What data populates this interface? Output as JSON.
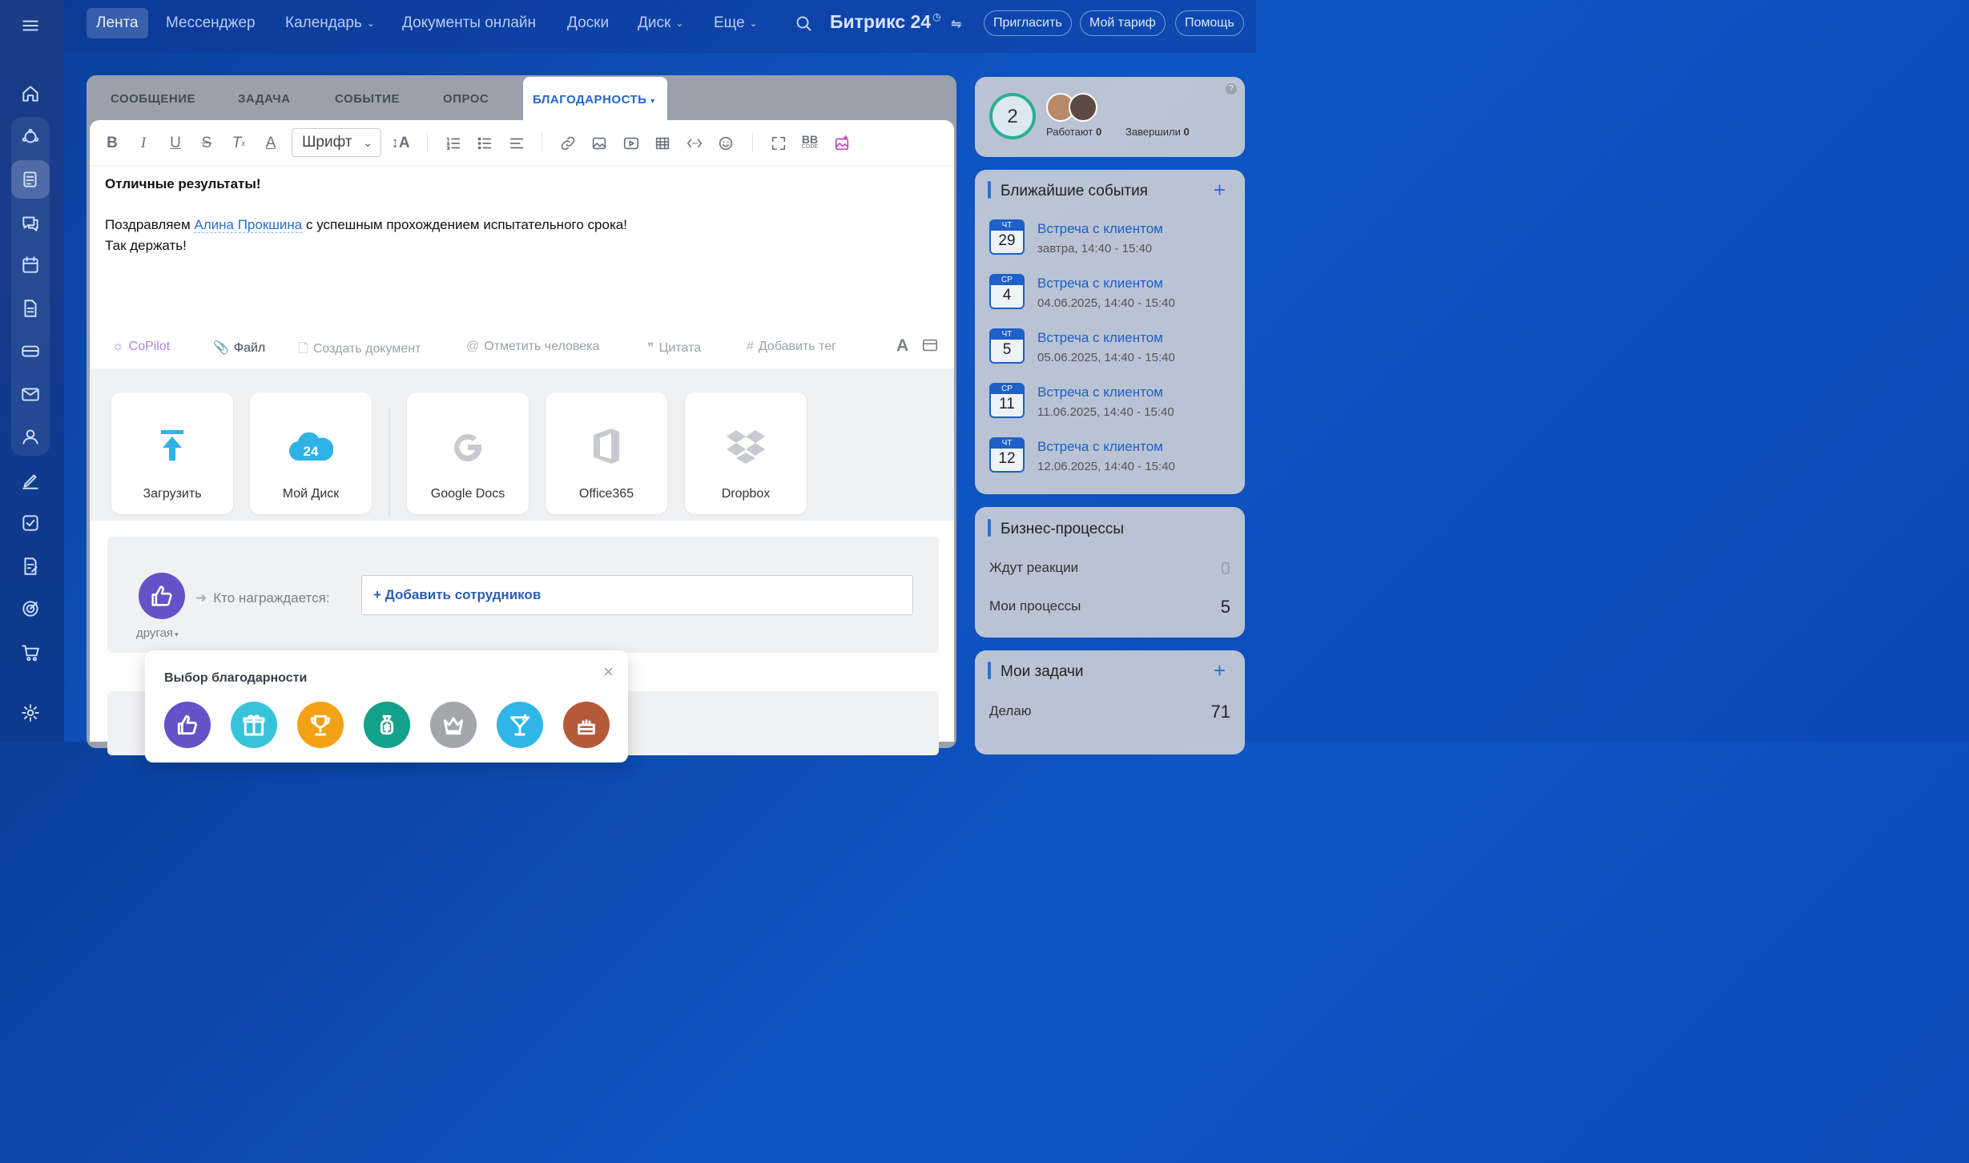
{
  "topbar": {
    "nav": [
      {
        "label": "Лента"
      },
      {
        "label": "Мессенджер"
      },
      {
        "label": "Календарь"
      },
      {
        "label": "Документы онлайн"
      },
      {
        "label": "Доски"
      },
      {
        "label": "Диск"
      },
      {
        "label": "Еще"
      }
    ],
    "brand": "Битрикс 24",
    "invite": "Пригласить",
    "tariff": "Мой тариф",
    "help": "Помощь"
  },
  "composer": {
    "tabs": [
      "СООБЩЕНИЕ",
      "ЗАДАЧА",
      "СОБЫТИЕ",
      "ОПРОС",
      "БЛАГОДАРНОСТЬ"
    ],
    "font_select": "Шрифт",
    "bbcode": "BB",
    "bbcode_sub": "CODE",
    "message_title": "Отличные результаты!",
    "line1_prefix": "Поздравляем",
    "line1_mention": "Алина Прокшина",
    "line1_suffix": "с успешным прохождением испытательного срока!",
    "line2": "Так держать!",
    "actions": {
      "copilot": "CoPilot",
      "file": "Файл",
      "create_doc": "Создать документ",
      "mention": "Отметить человека",
      "quote": "Цитата",
      "tag": "Добавить тег"
    },
    "upload_cards": [
      "Загрузить",
      "Мой Диск",
      "Google Docs",
      "Office365",
      "Dropbox"
    ],
    "gratitude": {
      "who_label": "Кто награждается:",
      "add_employees": "+ Добавить сотрудников",
      "kind": "другая"
    },
    "popup": {
      "title": "Выбор благодарности",
      "close": "×"
    }
  },
  "right": {
    "online_count": "2",
    "working_label": "Работают",
    "working_value": "0",
    "done_label": "Завершили",
    "done_value": "0",
    "events_title": "Ближайшие события",
    "events": [
      {
        "dow": "ЧТ",
        "day": "29",
        "title": "Встреча с клиентом",
        "time": "завтра, 14:40 - 15:40"
      },
      {
        "dow": "СР",
        "day": "4",
        "title": "Встреча с клиентом",
        "time": "04.06.2025, 14:40 - 15:40"
      },
      {
        "dow": "ЧТ",
        "day": "5",
        "title": "Встреча с клиентом",
        "time": "05.06.2025, 14:40 - 15:40"
      },
      {
        "dow": "СР",
        "day": "11",
        "title": "Встреча с клиентом",
        "time": "11.06.2025, 14:40 - 15:40"
      },
      {
        "dow": "ЧТ",
        "day": "12",
        "title": "Встреча с клиентом",
        "time": "12.06.2025, 14:40 - 15:40"
      }
    ],
    "bp_title": "Бизнес-процессы",
    "bp_rows": [
      {
        "label": "Ждут реакции",
        "value": "0"
      },
      {
        "label": "Мои процессы",
        "value": "5"
      }
    ],
    "tasks_title": "Мои задачи",
    "tasks_rows": [
      {
        "label": "Делаю",
        "value": "71"
      }
    ]
  },
  "colors": {
    "accent": "#2466c9",
    "gratitude_purple": "#6552c7"
  }
}
